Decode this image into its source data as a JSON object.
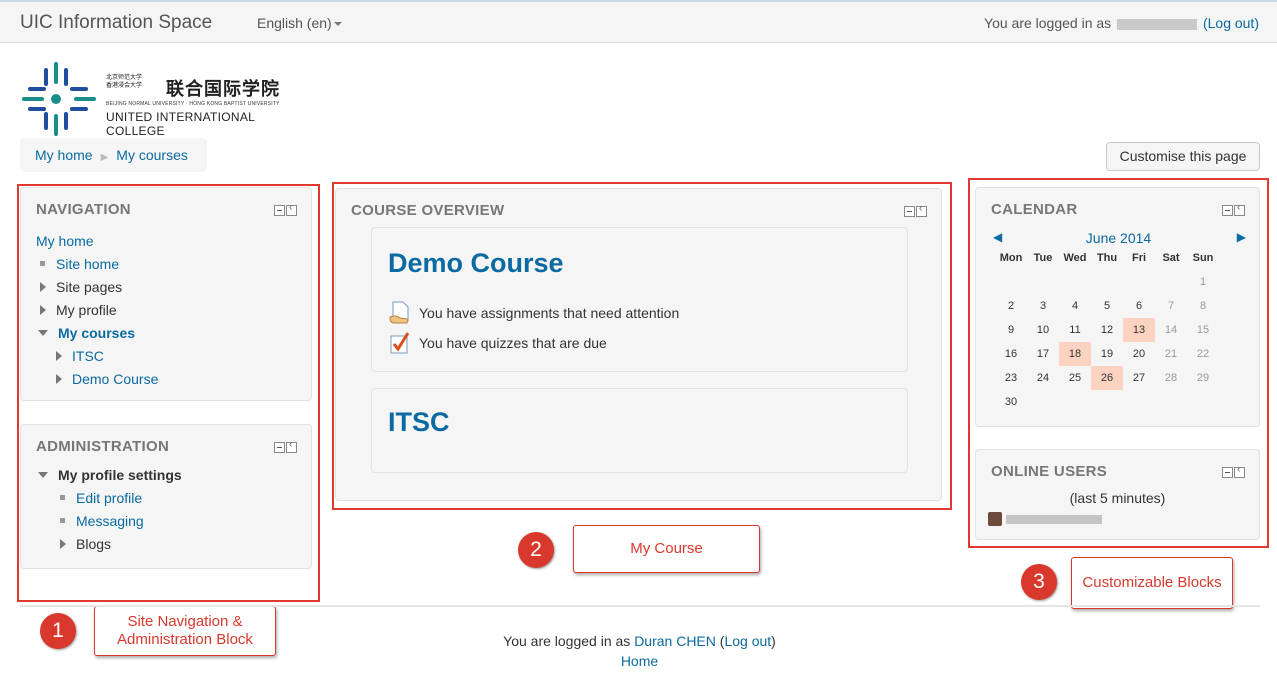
{
  "topbar": {
    "site_title": "UIC Information Space",
    "language": "English (en)",
    "login_prefix": "You are logged in as",
    "logout": "(Log out)"
  },
  "logo": {
    "cn_small_1": "北京师范大学",
    "cn_small_2": "香港浸会大学",
    "cn_name": "联合国际学院",
    "en_line1": "BEIJING NORMAL UNIVERSITY · HONG KONG BAPTIST UNIVERSITY",
    "en_line2": "UNITED INTERNATIONAL COLLEGE",
    "colors": {
      "teal": "#1a8f8a",
      "blue": "#1f4f9c"
    }
  },
  "breadcrumb": {
    "home": "My home",
    "courses": "My courses"
  },
  "customise_button": "Customise this page",
  "navigation": {
    "title": "NAVIGATION",
    "home": "My home",
    "site_home": "Site home",
    "site_pages": "Site pages",
    "my_profile": "My profile",
    "my_courses": "My courses",
    "course_itsc": "ITSC",
    "course_demo": "Demo Course"
  },
  "administration": {
    "title": "ADMINISTRATION",
    "profile_settings": "My profile settings",
    "edit_profile": "Edit profile",
    "messaging": "Messaging",
    "blogs": "Blogs"
  },
  "course_overview": {
    "title": "COURSE OVERVIEW",
    "course1": {
      "name": "Demo Course",
      "note1": "You have assignments that need attention",
      "note2": "You have quizzes that are due"
    },
    "course2": {
      "name": "ITSC"
    }
  },
  "calendar": {
    "title": "CALENDAR",
    "month": "June 2014",
    "prev": "◀",
    "next": "▶",
    "days": [
      "Mon",
      "Tue",
      "Wed",
      "Thu",
      "Fri",
      "Sat",
      "Sun"
    ],
    "dates": [
      [
        "",
        "",
        "",
        "",
        "",
        "",
        "1"
      ],
      [
        "2",
        "3",
        "4",
        "5",
        "6",
        "7",
        "8"
      ],
      [
        "9",
        "10",
        "11",
        "12",
        "13",
        "14",
        "15"
      ],
      [
        "16",
        "17",
        "18",
        "19",
        "20",
        "21",
        "22"
      ],
      [
        "23",
        "24",
        "25",
        "26",
        "27",
        "28",
        "29"
      ],
      [
        "30",
        "",
        "",
        "",
        "",
        "",
        ""
      ]
    ],
    "event_dates": [
      "13",
      "18",
      "26"
    ],
    "event_color": "#fbd3c0"
  },
  "online_users": {
    "title": "ONLINE USERS",
    "subtitle": "(last 5 minutes)"
  },
  "annotations": {
    "n1": "1",
    "label1": "Site Navigation & Administration Block",
    "n2": "2",
    "label2": "My Course",
    "n3": "3",
    "label3": "Customizable Blocks",
    "color": "#e03a2f"
  },
  "footer": {
    "login_prefix": "You are logged in as",
    "user": "Duran CHEN",
    "logout": "Log out",
    "home": "Home"
  }
}
